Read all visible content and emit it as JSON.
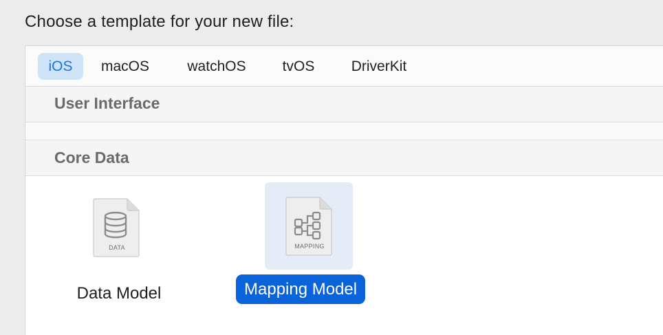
{
  "prompt": "Choose a template for your new file:",
  "tabs": [
    {
      "label": "iOS",
      "selected": true
    },
    {
      "label": "macOS",
      "selected": false
    },
    {
      "label": "watchOS",
      "selected": false
    },
    {
      "label": "tvOS",
      "selected": false
    },
    {
      "label": "DriverKit",
      "selected": false
    }
  ],
  "sections": [
    {
      "title": "User Interface"
    },
    {
      "title": "Core Data"
    }
  ],
  "templates": [
    {
      "name": "Data Model",
      "icon_label": "DATA",
      "icon": "database-document-icon",
      "selected": false
    },
    {
      "name": "Mapping Model",
      "icon_label": "MAPPING",
      "icon": "mapping-document-icon",
      "selected": true
    }
  ],
  "colors": {
    "accent": "#0a63d8",
    "selected_tab_bg": "#cfe3f9",
    "selected_tile_bg": "#e5ecf8"
  }
}
